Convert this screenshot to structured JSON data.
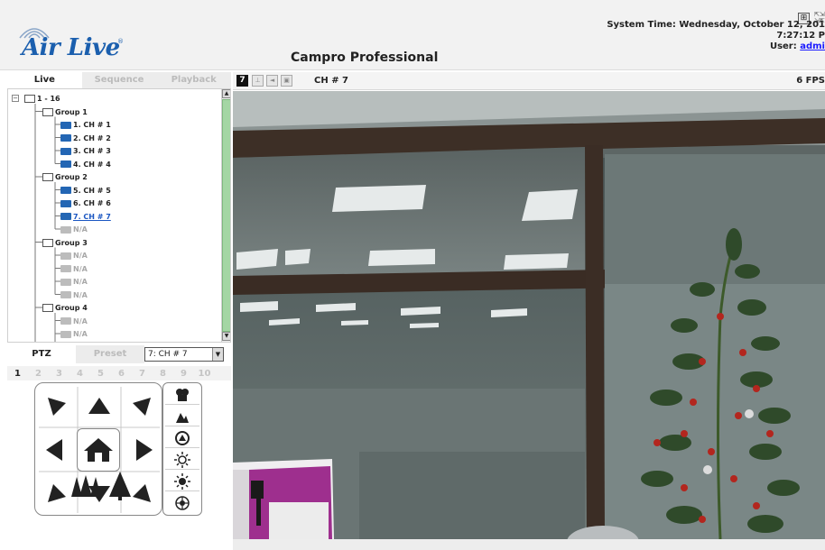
{
  "header": {
    "brand": "Air Live",
    "brand_mark": "®",
    "app_title": "Campro Professional",
    "system_time_label": "System Time: Wednesday, October 12, 201",
    "time": "7:27:12 P",
    "user_label": "User: ",
    "user_name": "admi"
  },
  "tabs": [
    "Live",
    "Sequence",
    "Playback"
  ],
  "tree": {
    "root": "1 - 16",
    "groups": [
      {
        "label": "Group 1",
        "items": [
          {
            "label": "1. CH # 1",
            "state": "online"
          },
          {
            "label": "2. CH # 2",
            "state": "online"
          },
          {
            "label": "3. CH # 3",
            "state": "online"
          },
          {
            "label": "4. CH # 4",
            "state": "online"
          }
        ]
      },
      {
        "label": "Group 2",
        "items": [
          {
            "label": "5. CH # 5",
            "state": "online"
          },
          {
            "label": "6. CH # 6",
            "state": "online"
          },
          {
            "label": "7. CH # 7",
            "state": "selected"
          },
          {
            "label": "N/A",
            "state": "na"
          }
        ]
      },
      {
        "label": "Group 3",
        "items": [
          {
            "label": "N/A",
            "state": "na"
          },
          {
            "label": "N/A",
            "state": "na"
          },
          {
            "label": "N/A",
            "state": "na"
          },
          {
            "label": "N/A",
            "state": "na"
          }
        ]
      },
      {
        "label": "Group 4",
        "items": [
          {
            "label": "N/A",
            "state": "na"
          },
          {
            "label": "N/A",
            "state": "na"
          },
          {
            "label": "N/A",
            "state": "na"
          }
        ]
      }
    ]
  },
  "ptz": {
    "tabs": [
      "PTZ",
      "Preset"
    ],
    "preset_value": "7: CH # 7",
    "numbers": [
      "1",
      "2",
      "3",
      "4",
      "5",
      "6",
      "7",
      "8",
      "9",
      "10"
    ],
    "active_number": "1"
  },
  "video": {
    "channel_number": "7",
    "channel_name": "CH # 7",
    "fps": "6 FPS"
  },
  "colors": {
    "accent": "#1b5fae",
    "camera_online": "#2366b4",
    "camera_na": "#bcbcbc",
    "scroll_thumb": "#a4d6a4"
  }
}
